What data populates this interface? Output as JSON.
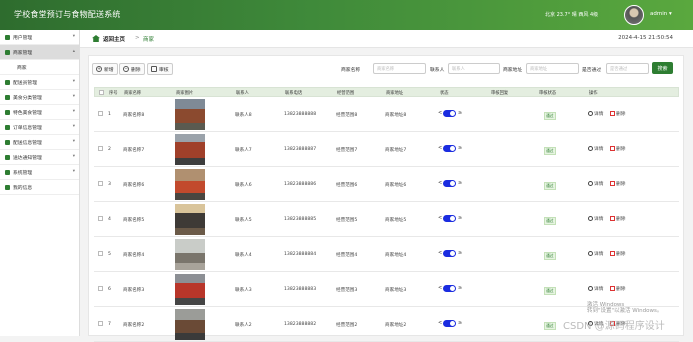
{
  "header": {
    "app_title": "学校食堂预订与食物配送系统",
    "weather": "北京 23.7° 晴 西风 4级",
    "user": "admin ▾"
  },
  "sidebar": {
    "items": [
      {
        "label": "用户管理",
        "active": false
      },
      {
        "label": "商家管理",
        "active": true
      },
      {
        "label": "配送员管理",
        "active": false
      },
      {
        "label": "美食分类管理",
        "active": false
      },
      {
        "label": "特色美食管理",
        "active": false
      },
      {
        "label": "订单信息管理",
        "active": false
      },
      {
        "label": "配送信息管理",
        "active": false
      },
      {
        "label": "送达通知管理",
        "active": false
      },
      {
        "label": "系统管理",
        "active": false
      },
      {
        "label": "我的信息",
        "active": false
      }
    ],
    "sub_item": "商家"
  },
  "breadcrumb": {
    "home": "返回主页",
    "separator": ">",
    "current": "商家",
    "datetime": "2024-4-15 21:50:54"
  },
  "toolbar": {
    "add": "新增",
    "delete": "删除",
    "audit": "审核",
    "search_button": "搜索",
    "filters": [
      {
        "label": "商家名称",
        "placeholder": "商家名称"
      },
      {
        "label": "联系人",
        "placeholder": "联系人"
      },
      {
        "label": "商家地址",
        "placeholder": "商家地址"
      },
      {
        "label": "是否通过",
        "placeholder": "是否通过"
      }
    ]
  },
  "table": {
    "columns": [
      "序号",
      "商家名称",
      "商家图片",
      "联系人",
      "联系电话",
      "经营范围",
      "商家地址",
      "状态",
      "审核回复",
      "审核状态",
      "操作"
    ],
    "rows": [
      {
        "no": "1",
        "name": "商家名称8",
        "contact": "联系人8",
        "phone": "13823888888",
        "scope": "经营范围8",
        "address": "商家地址8",
        "status": "通过"
      },
      {
        "no": "2",
        "name": "商家名称7",
        "contact": "联系人7",
        "phone": "13823888887",
        "scope": "经营范围7",
        "address": "商家地址7",
        "status": "通过"
      },
      {
        "no": "3",
        "name": "商家名称6",
        "contact": "联系人6",
        "phone": "13823888886",
        "scope": "经营范围6",
        "address": "商家地址6",
        "status": "通过"
      },
      {
        "no": "4",
        "name": "商家名称5",
        "contact": "联系人5",
        "phone": "13823888885",
        "scope": "经营范围5",
        "address": "商家地址5",
        "status": "通过"
      },
      {
        "no": "5",
        "name": "商家名称4",
        "contact": "联系人4",
        "phone": "13823888884",
        "scope": "经营范围4",
        "address": "商家地址4",
        "status": "通过"
      },
      {
        "no": "6",
        "name": "商家名称3",
        "contact": "联系人3",
        "phone": "13823888883",
        "scope": "经营范围3",
        "address": "商家地址3",
        "status": "通过"
      },
      {
        "no": "7",
        "name": "商家名称2",
        "contact": "联系人2",
        "phone": "13823888882",
        "scope": "经营范围2",
        "address": "商家地址2",
        "status": "通过"
      }
    ],
    "switch_left": "<",
    "switch_right": "≥",
    "detail": "详情",
    "remove": "删除"
  },
  "watermark": {
    "line1": "激活 Windows",
    "line2": "转到\"设置\"以激活 Windows。",
    "line3": "CSDN @源码程序设计"
  }
}
